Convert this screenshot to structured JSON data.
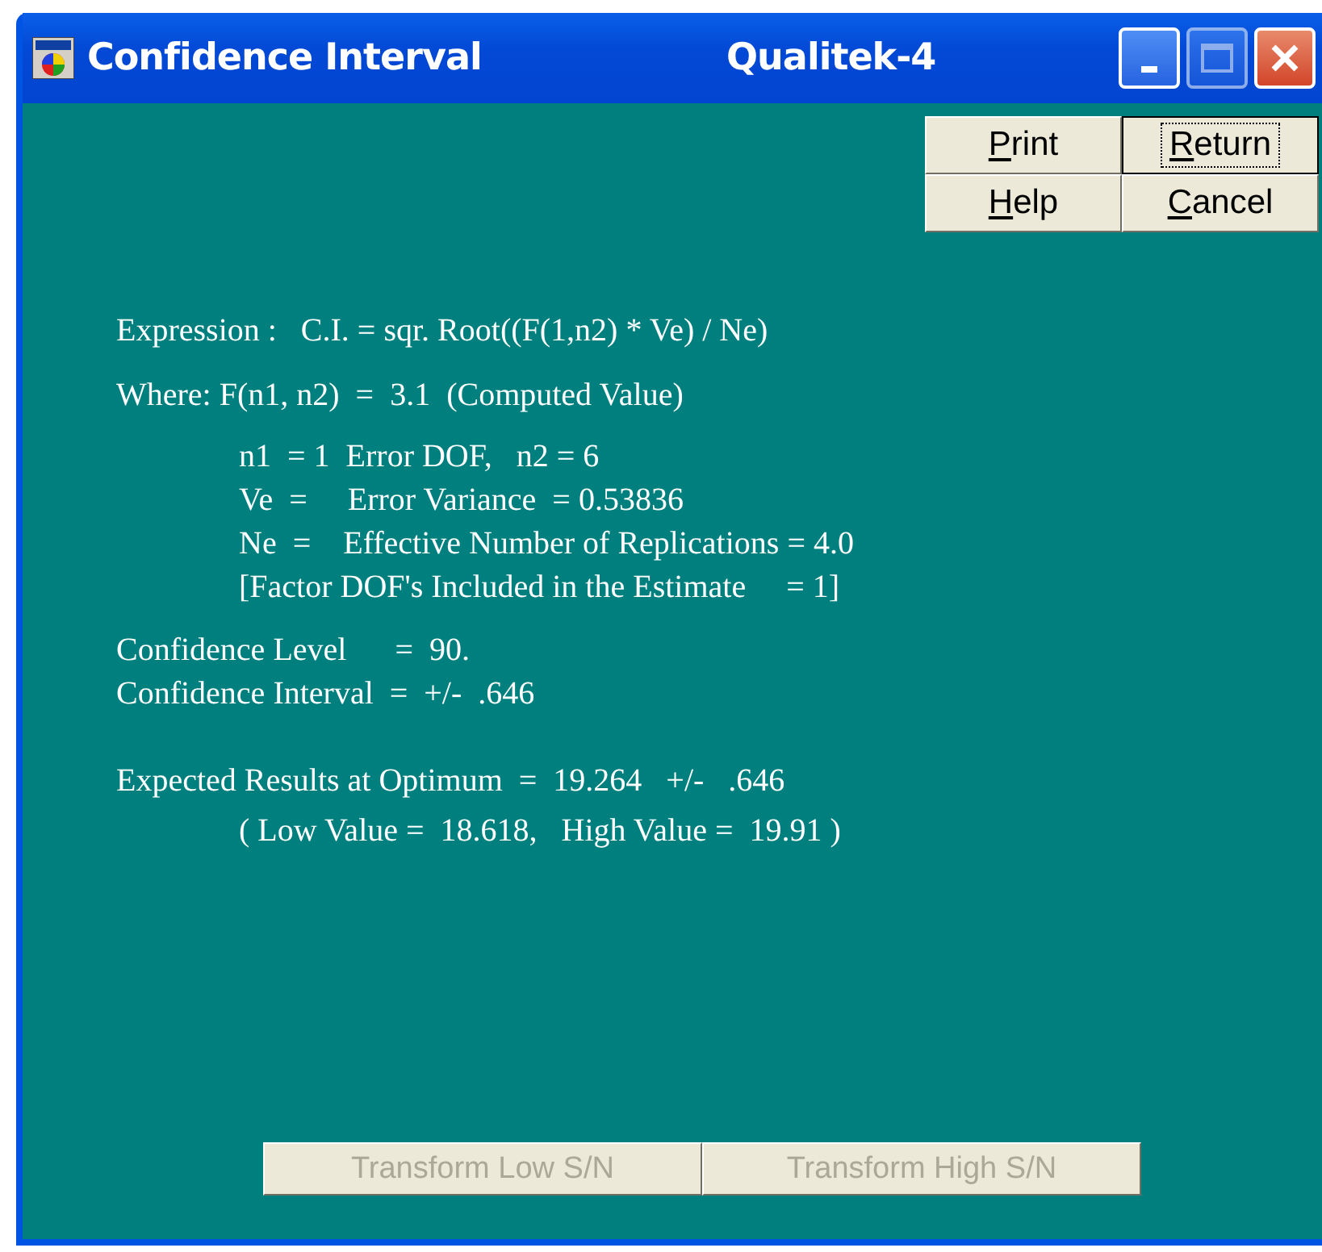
{
  "window": {
    "title": "Confidence Interval",
    "app_name": "Qualitek-4",
    "maximize_disabled": true
  },
  "buttons": [
    {
      "label": "Print",
      "focused": false
    },
    {
      "label": "Return",
      "focused": true
    },
    {
      "label": "Help",
      "focused": false
    },
    {
      "label": "Cancel",
      "focused": false
    }
  ],
  "expression": "Expression :   C.I. = sqr. Root((F(1,n2) * Ve) / Ne)",
  "where": "Where: F(n1, n2)  =  3.1  (Computed Value)",
  "details": [
    "n1  = 1  Error DOF,   n2 = 6",
    "Ve  =     Error Variance  = 0.53836",
    "Ne  =    Effective Number of Replications = 4.0",
    "[Factor DOF's Included in the Estimate     = 1]"
  ],
  "confidence": [
    "Confidence Level      =  90.",
    "Confidence Interval  =  +/-  .646"
  ],
  "expected": {
    "result": "Expected Results at Optimum  =  19.264   +/-   .646",
    "range": "( Low Value =  18.618,   High Value =  19.91 )"
  },
  "transform_buttons": [
    {
      "label": "Transform Low S/N",
      "disabled": true
    },
    {
      "label": "Transform High S/N",
      "disabled": true
    }
  ]
}
